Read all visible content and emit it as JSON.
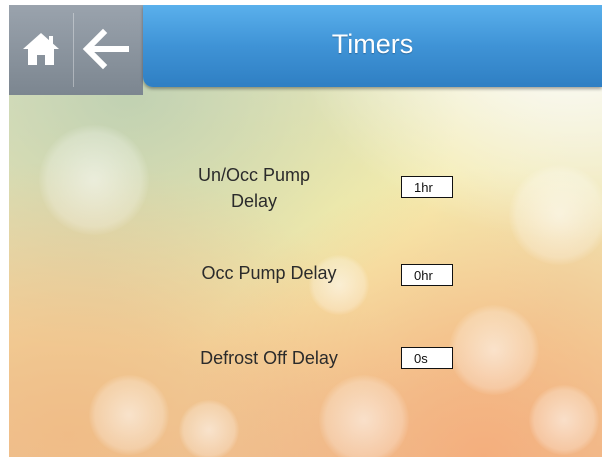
{
  "header": {
    "title": "Timers",
    "home_icon": "home-icon",
    "back_icon": "arrow-left-icon"
  },
  "settings": [
    {
      "label": "Un/Occ Pump Delay",
      "value": "1hr"
    },
    {
      "label": "Occ Pump Delay",
      "value": "0hr"
    },
    {
      "label": "Defrost Off Delay",
      "value": "0s"
    }
  ],
  "colors": {
    "title_bar": "#3f93d6",
    "nav_panel": "#8a939d"
  }
}
